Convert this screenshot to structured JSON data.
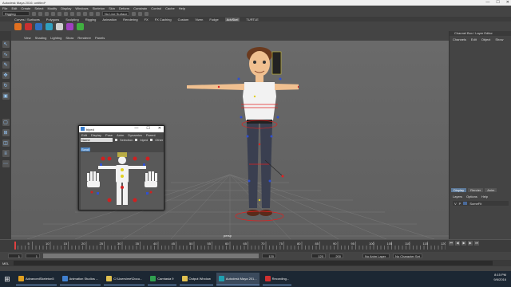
{
  "window": {
    "title": "Autodesk Maya 2016: untitled*",
    "controls": [
      "—",
      "☐",
      "✕"
    ]
  },
  "menubar": [
    "File",
    "Edit",
    "Create",
    "Select",
    "Modify",
    "Display",
    "Windows",
    "Skeleton",
    "Skin",
    "Deform",
    "Constrain",
    "Control",
    "Cache",
    "Help"
  ],
  "statusline": {
    "mode": "Rigging",
    "surface": "No Live Surface"
  },
  "shelf": {
    "tabs": [
      "Curves / Surfaces",
      "Polygons",
      "Sculpting",
      "Rigging",
      "Animation",
      "Rendering",
      "FX",
      "FX Caching",
      "Custom",
      "Vizen",
      "Fudge",
      "AdvSkel",
      "TURTLE"
    ],
    "active_tab": "AdvSkel",
    "icon_colors": [
      "#e07020",
      "#c83030",
      "#3070c0",
      "#30a0c0",
      "#d0d0d0",
      "#a040c0",
      "#40b040"
    ]
  },
  "panel_menu": [
    "View",
    "Shading",
    "Lighting",
    "Show",
    "Renderer",
    "Panels"
  ],
  "viewport": {
    "camera": "persp"
  },
  "channel_box": {
    "header": "Channel Box / Layer Editor",
    "tabs": [
      "Channels",
      "Edit",
      "Object",
      "Show"
    ],
    "layer_tabs": [
      "Display",
      "Render",
      "Anim"
    ],
    "layer_menu": [
      "Layers",
      "Options",
      "Help"
    ],
    "layer_row": {
      "v": "V",
      "p": "P",
      "name": "SomeFit"
    }
  },
  "timeline": {
    "ticks": [
      "5",
      "10",
      "15",
      "20",
      "25",
      "30",
      "35",
      "40",
      "45",
      "50",
      "55",
      "60",
      "65",
      "70",
      "75",
      "80",
      "85",
      "90",
      "95",
      "100",
      "105",
      "110",
      "115",
      "120"
    ],
    "current_frame": "1"
  },
  "range": {
    "start": "1",
    "inner_start": "1",
    "inner_end": "120",
    "end": "120",
    "max_end": "200",
    "anim_layer": "No Anim Layer",
    "char_set": "No Character Set"
  },
  "command_line": {
    "label": "MEL"
  },
  "biped": {
    "title": "biped",
    "menu": [
      "Edit",
      "Display",
      "Pose",
      "Anim",
      "Dynamics",
      "Parent"
    ],
    "selector": "Name",
    "selection_label": "Selection",
    "biped_label": "biped",
    "other_label": "Other",
    "chosen_item": "Scroll"
  },
  "taskbar": {
    "apps": [
      {
        "label": "AdvancedSkeleton5",
        "color": "#e0a020"
      },
      {
        "label": "Animation Studios ...",
        "color": "#4080d0"
      },
      {
        "label": "C:\\Users\\me\\Docu...",
        "color": "#e0c050"
      },
      {
        "label": "Camtasia 9",
        "color": "#30a050"
      },
      {
        "label": "Output Window",
        "color": "#e0c050"
      },
      {
        "label": "Autodesk Maya 201...",
        "color": "#20a0b0"
      },
      {
        "label": "Recording...",
        "color": "#d03030"
      }
    ],
    "time": "8:15 PM",
    "date": "9/6/2016"
  }
}
